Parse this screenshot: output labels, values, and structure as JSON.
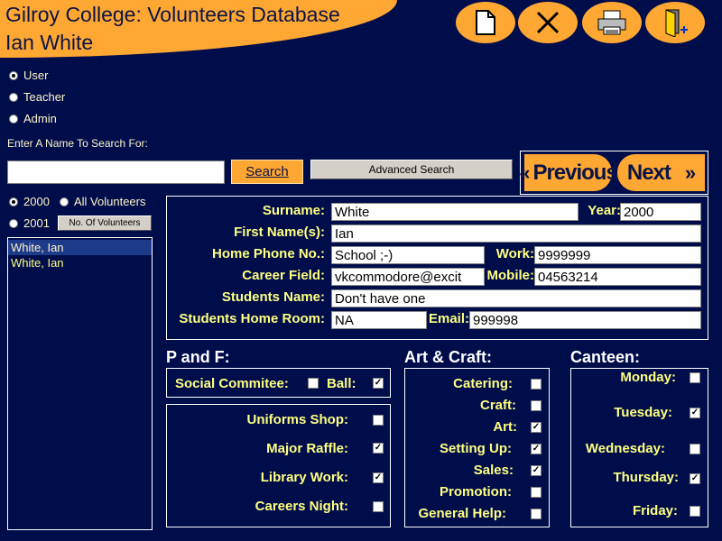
{
  "app": {
    "title": "Gilroy College: Volunteers Database",
    "user_name": "Ian White"
  },
  "toolbar": {
    "buttons": [
      {
        "name": "new-document-icon"
      },
      {
        "name": "delete-icon"
      },
      {
        "name": "print-icon"
      },
      {
        "name": "exit-icon"
      }
    ]
  },
  "roles": [
    {
      "label": "User",
      "selected": true
    },
    {
      "label": "Teacher",
      "selected": false
    },
    {
      "label": "Admin",
      "selected": false
    }
  ],
  "search": {
    "prompt": "Enter A Name To Search For:",
    "value": "",
    "search_label": "Search",
    "advanced_label": "Advanced Search"
  },
  "nav": {
    "previous_label": "Previous",
    "next_label": "Next"
  },
  "filters": {
    "year_2000": "2000",
    "year_2001": "2001",
    "all_volunteers": "All Volunteers",
    "count_button": "No. Of Volunteers"
  },
  "volunteer_list": [
    "White, Ian",
    "White, Ian"
  ],
  "details": {
    "surname_label": "Surname:",
    "surname": "White",
    "year_label": "Year:",
    "year": "2000",
    "first_name_label": "First Name(s):",
    "first_name": "Ian",
    "home_phone_label": "Home Phone No.:",
    "home_phone": "School ;-)",
    "work_label": "Work:",
    "work": "9999999",
    "career_label": "Career Field:",
    "career": "vkcommodore@excit",
    "mobile_label": "Mobile:",
    "mobile": "04563214",
    "students_name_label": "Students Name:",
    "students_name": "Don't have one",
    "home_room_label": "Students Home Room:",
    "home_room": "NA",
    "email_label": "Email:",
    "email": "999998"
  },
  "pf": {
    "title": "P and F:",
    "social_label": "Social Commitee:",
    "social_checked": false,
    "ball_label": "Ball:",
    "ball_checked": true,
    "items": [
      {
        "label": "Uniforms Shop:",
        "checked": false
      },
      {
        "label": "Major Raffle:",
        "checked": true
      },
      {
        "label": "Library Work:",
        "checked": true
      },
      {
        "label": "Careers Night:",
        "checked": false
      }
    ]
  },
  "art": {
    "title": "Art & Craft:",
    "items": [
      {
        "label": "Catering:",
        "checked": false
      },
      {
        "label": "Craft:",
        "checked": false
      },
      {
        "label": "Art:",
        "checked": true
      },
      {
        "label": "Setting Up:",
        "checked": true
      },
      {
        "label": "Sales:",
        "checked": true
      },
      {
        "label": "Promotion:",
        "checked": false
      },
      {
        "label": "General Help:",
        "checked": false
      }
    ]
  },
  "canteen": {
    "title": "Canteen:",
    "items": [
      {
        "label": "Monday:",
        "checked": false
      },
      {
        "label": "Tuesday:",
        "checked": true
      },
      {
        "label": "Wednesday:",
        "checked": false
      },
      {
        "label": "Thursday:",
        "checked": true
      },
      {
        "label": "Friday:",
        "checked": false
      }
    ]
  },
  "colors": {
    "background": "#000d4b",
    "accent": "#ffa733",
    "label": "#ffff80"
  }
}
